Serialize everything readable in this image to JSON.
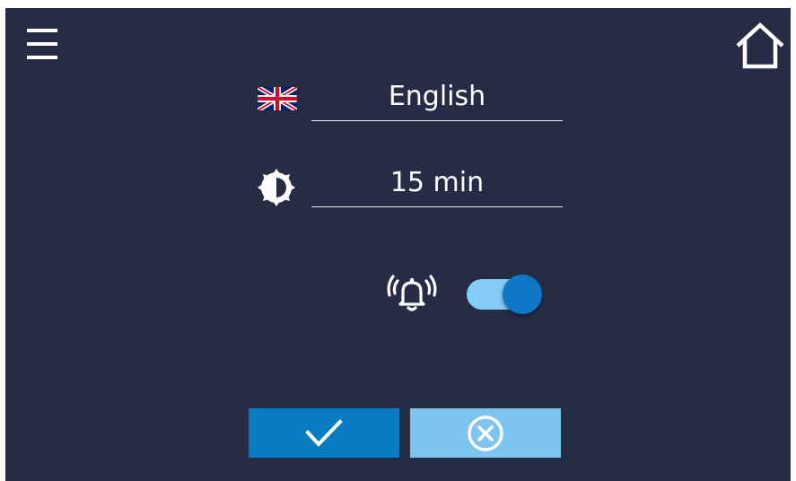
{
  "header": {
    "menu_icon": "hamburger-menu-icon",
    "home_icon": "home-icon"
  },
  "settings": {
    "language": {
      "icon": "uk-flag-icon",
      "value": "English"
    },
    "screen_timeout": {
      "icon": "brightness-icon",
      "value": "15 min"
    },
    "alarm_sound": {
      "icon": "ringing-bell-icon",
      "enabled": true
    }
  },
  "actions": {
    "confirm_icon": "checkmark-icon",
    "cancel_icon": "cancel-circle-x-icon"
  },
  "colors": {
    "background": "#262c46",
    "text": "#ffffff",
    "toggle_track": "#83cdf7",
    "toggle_knob": "#0f78c6",
    "confirm_button": "#087cc3",
    "cancel_button": "#7dc4ee"
  }
}
